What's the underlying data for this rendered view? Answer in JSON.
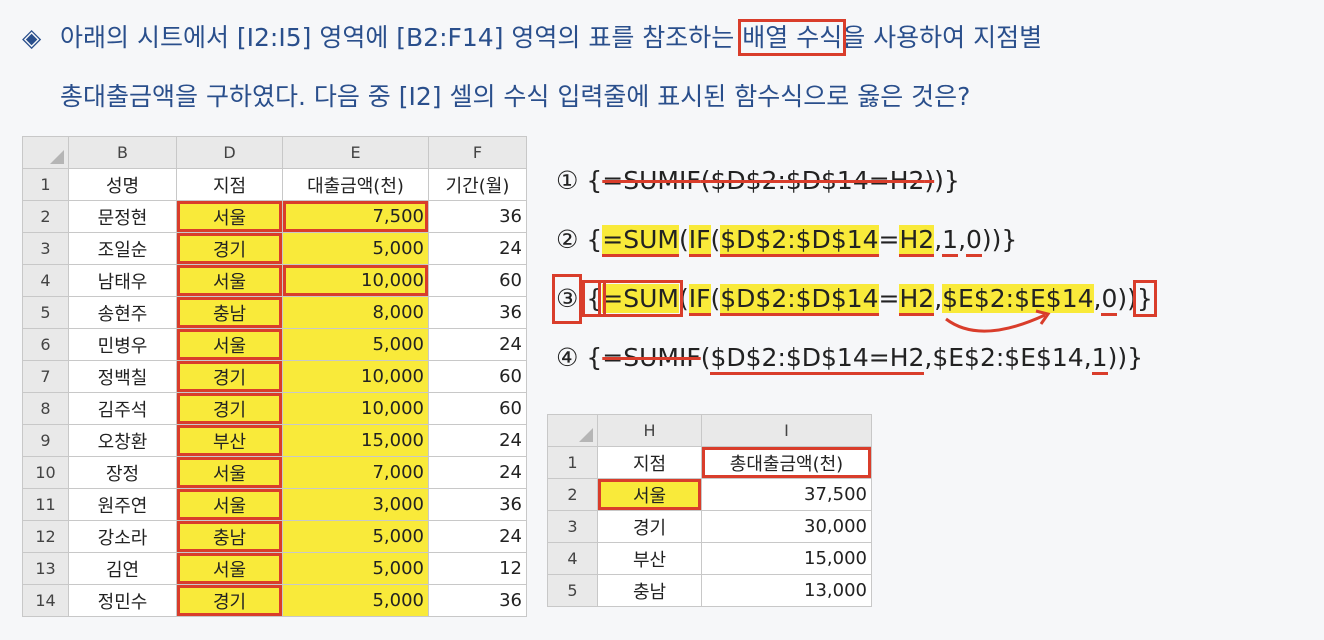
{
  "question": {
    "bullet": "◈",
    "line1_a": "아래의 시트에서 [I2:I5] 영역에 [B2:F14] 영역의 표를 참조하는 ",
    "line1_boxed": "배열 수식",
    "line1_b": "을 사용하여 지점별",
    "line2": "총대출금액을 구하였다. 다음 중 [I2] 셀의 수식 입력줄에 표시된 함수식으로 옳은 것은?"
  },
  "sheet1": {
    "col_headers": [
      "B",
      "D",
      "E",
      "F"
    ],
    "header_row": [
      "1",
      "성명",
      "지점",
      "대출금액(천)",
      "기간(월)"
    ],
    "rows": [
      [
        "2",
        "문정현",
        "서울",
        "7,500",
        "36"
      ],
      [
        "3",
        "조일순",
        "경기",
        "5,000",
        "24"
      ],
      [
        "4",
        "남태우",
        "서울",
        "10,000",
        "60"
      ],
      [
        "5",
        "송현주",
        "충남",
        "8,000",
        "36"
      ],
      [
        "6",
        "민병우",
        "서울",
        "5,000",
        "24"
      ],
      [
        "7",
        "정백칠",
        "경기",
        "10,000",
        "60"
      ],
      [
        "8",
        "김주석",
        "경기",
        "10,000",
        "60"
      ],
      [
        "9",
        "오창환",
        "부산",
        "15,000",
        "24"
      ],
      [
        "10",
        "장정",
        "서울",
        "7,000",
        "24"
      ],
      [
        "11",
        "원주연",
        "서울",
        "3,000",
        "36"
      ],
      [
        "12",
        "강소라",
        "충남",
        "5,000",
        "24"
      ],
      [
        "13",
        "김연",
        "서울",
        "5,000",
        "12"
      ],
      [
        "14",
        "정민수",
        "경기",
        "5,000",
        "36"
      ]
    ]
  },
  "sheet2": {
    "col_headers": [
      "H",
      "I"
    ],
    "header_row": [
      "1",
      "지점",
      "총대출금액(천)"
    ],
    "rows": [
      [
        "2",
        "서울",
        "37,500"
      ],
      [
        "3",
        "경기",
        "30,000"
      ],
      [
        "4",
        "부산",
        "15,000"
      ],
      [
        "5",
        "충남",
        "13,000"
      ]
    ]
  },
  "options": {
    "o1": {
      "num": "①",
      "text": "{=SUMIF($D$2:$D$14=H2)}"
    },
    "o2": {
      "num": "②",
      "text": "{=SUM(IF($D$2:$D$14=H2,1,0))}"
    },
    "o3": {
      "num": "③",
      "text": "{=SUM(IF($D$2:$D$14=H2,$E$2:$E$14,0))}"
    },
    "o4": {
      "num": "④",
      "text": "{=SUMIF($D$2:$D$14=H2,$E$2:$E$14,1))}"
    }
  },
  "colors": {
    "highlight": "#f9ea3a",
    "annotation_red": "#d93d2b",
    "question_blue": "#2a4f8c"
  }
}
